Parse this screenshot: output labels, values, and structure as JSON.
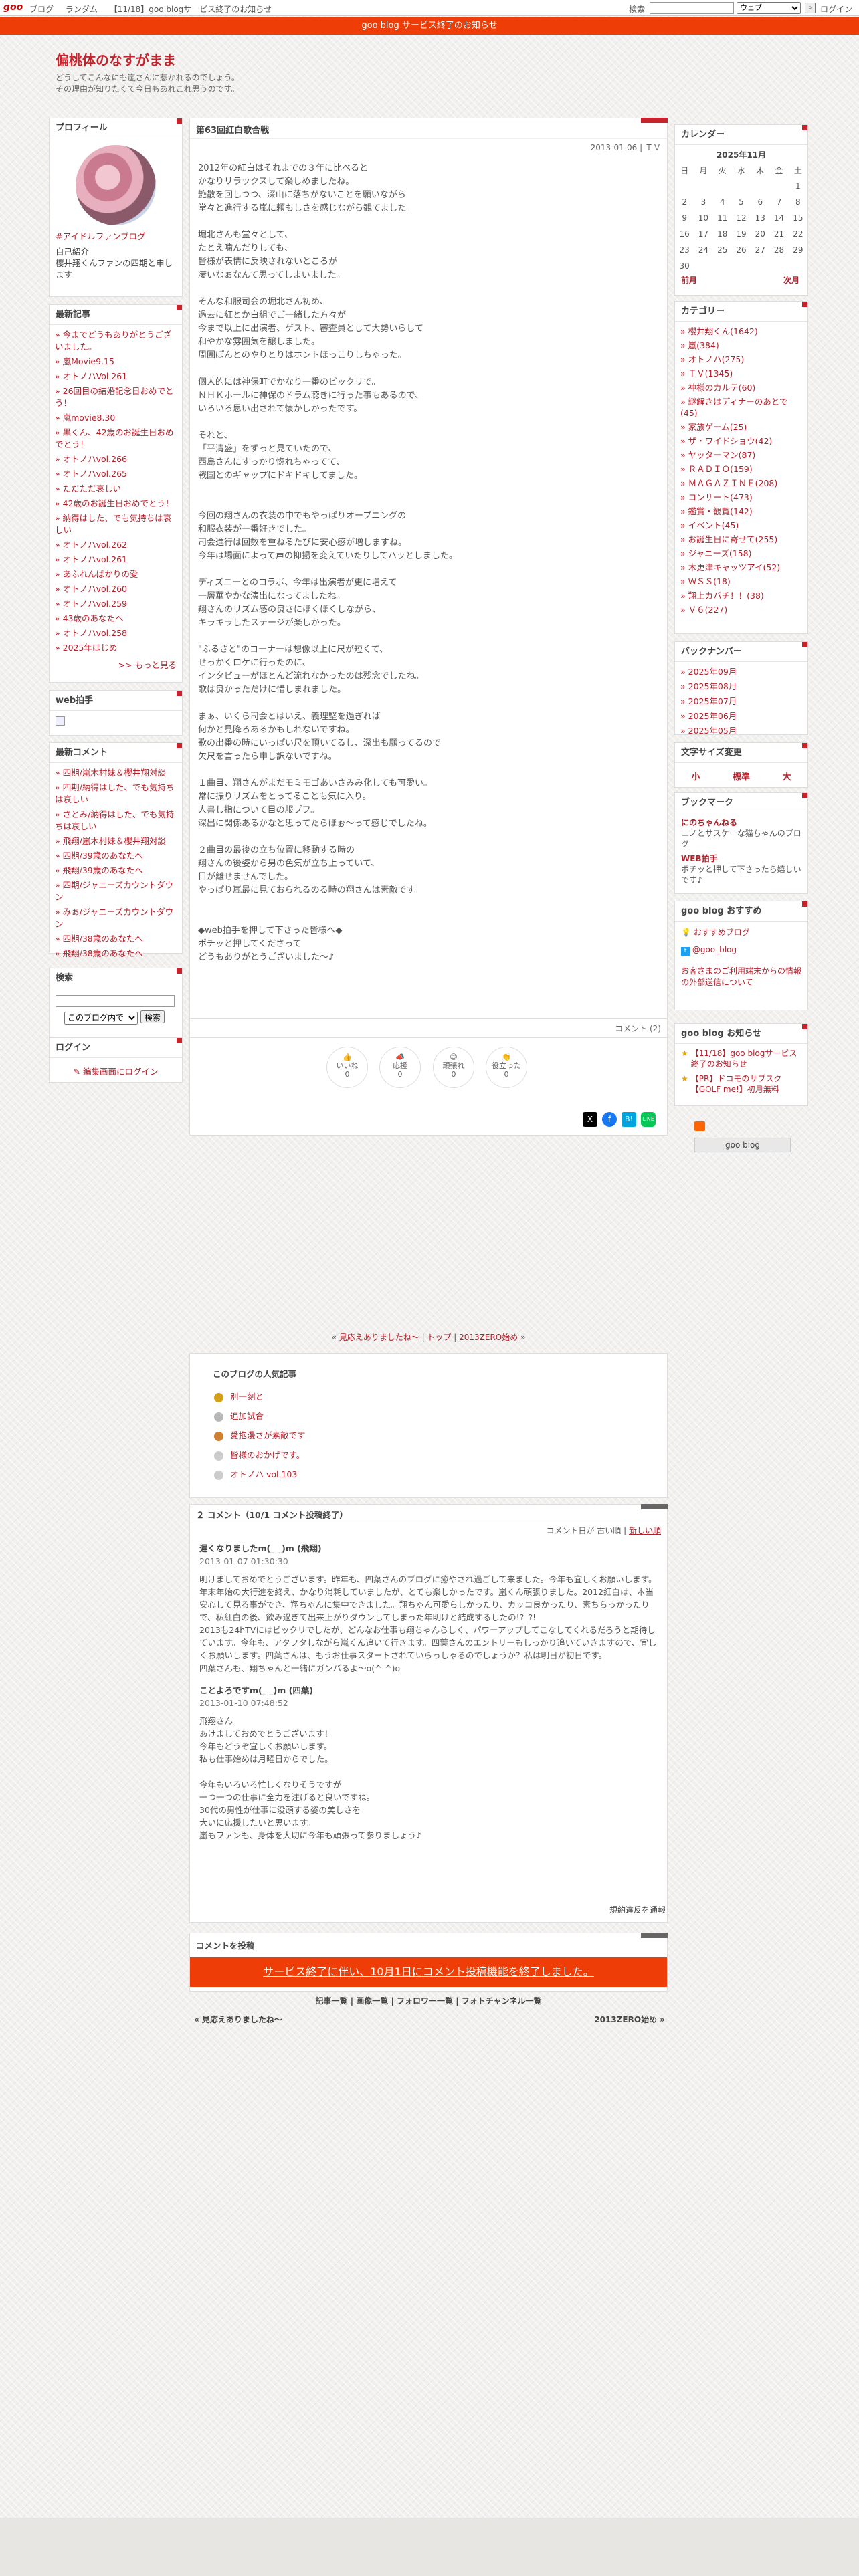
{
  "topbar": {
    "logo": "goo",
    "links": [
      "ブログ",
      "ランダム",
      "【11/18】goo blogサービス終了のお知らせ"
    ],
    "search_label": "検索",
    "search_select": "ウェブ",
    "login": "ログイン"
  },
  "notice": "goo blog サービス終了のお知らせ",
  "blog": {
    "title": "偏桃体のなすがまま",
    "desc_line1": "どうしてこんなにも嵐さんに惹かれるのでしょう。",
    "desc_line2": "その理由が知りたくて今日もあれこれ思うのです。"
  },
  "profile": {
    "heading": "プロフィール",
    "link": "#アイドルファンブログ",
    "intro_title": "自己紹介",
    "intro": "櫻井翔くんファンの四期と申します。"
  },
  "recent": {
    "heading": "最新記事",
    "items": [
      "今までどうもありがとうございました。",
      "嵐Movie9.15",
      "オトノハVol.261",
      "26回目の結婚記念日おめでとう！",
      "嵐movie8.30",
      "黒くん、42歳のお誕生日おめでとう！",
      "オトノハvol.266",
      "オトノハvol.265",
      "ただただ哀しい",
      "42歳のお誕生日おめでとう！",
      "納得はした、でも気持ちは哀しい",
      "オトノハvol.262",
      "オトノハvol.261",
      "あふれんばかりの愛",
      "オトノハvol.260",
      "オトノハvol.259",
      "43歳のあなたへ",
      "オトノハvol.258",
      "2025年ほじめ"
    ],
    "more": ">> もっと見る"
  },
  "webclap": {
    "heading": "web拍手"
  },
  "comments_side": {
    "heading": "最新コメント",
    "items": [
      "四期/嵐木村妹＆櫻井翔対談",
      "四期/納得はした、でも気持ちは哀しい",
      "さとみ/納得はした、でも気持ちは哀しい",
      "飛翔/嵐木村妹＆櫻井翔対談",
      "四期/39歳のあなたへ",
      "飛翔/39歳のあなたへ",
      "四期/ジャニーズカウントダウン",
      "みぁ/ジャニーズカウントダウン",
      "四期/38歳のあなたへ",
      "飛翔/38歳のあなたへ"
    ]
  },
  "search_side": {
    "heading": "検索",
    "select": "このブログ内で",
    "button": "検索"
  },
  "login_side": {
    "heading": "ログイン",
    "link": "編集画面にログイン"
  },
  "post": {
    "title": "第63回紅白歌合戦",
    "meta": "2013-01-06 | ＴＶ",
    "body": "2012年の紅白はそれまでの３年に比べると\nかなりリラックスして楽しめましたね。\n艶散を回しつつ、深山に落ちがないことを願いながら\n堂々と進行する嵐に頼もしさを感じながら観てました。\n\n堀北さんも堂々として、\nたとえ噛んだりしても、\n皆様が表情に反映されないところが\n凄いなぁなんて思ってしまいました。\n\nそんな和服司会の堀北さん初め、\n過去に紅とか白組でご一緒した方々が\n今まで以上に出演者、ゲスト、審査員として大勢いらして\n和やかな雰囲気を醸しました。\n周囲ぽんとのやりとりはホントほっこりしちゃった。\n\n個人的には神保町でかなり一番のビックリで。\nＮＨＫホールに神保のドラム聴きに行った事もあるので、\nいろいろ思い出されて懐かしかったです。\n\nそれと、\n「平清盛」をずっと見ていたので、\n西島さんにすっかり惚れちゃってて、\n戦国とのギャップにドキドキしてました。\n\n\n今回の翔さんの衣装の中でもやっぱりオープニングの\n和服衣装が一番好きでした。\n司会進行は回数を重ねるたびに安心感が増しますね。\n今年は場面によって声の抑揚を変えていたりしてハッとしました。\n\nディズニーとのコラボ、今年は出演者が更に増えて\n一層華やかな演出になってましたね。\n翔さんのリズム感の良さにほくほくしながら、\nキラキラしたステージが楽しかった。\n\n\"ふるさと\"のコーナーは想像以上に尺が短くて、\nせっかくロケに行ったのに、\nインタビューがほとんど流れなかったのは残念でしたね。\n歌は良かっただけに惜しまれました。\n\nまぁ、いくら司会とはいえ、義理堅を過ぎれば\n何かと見降ろあるかもしれないですね。\n歌の出番の時にいっぱい尺を頂いてるし、深出も願ってるので\n欠尺を言ったら申し訳ないですね。\n\n１曲目、翔さんがまだモミモゴあいさみみ化しても可愛い。\n常に振りリズムをとってることも気に入り。\n人書し指について目の服プフ。\n深出に関係あるかなと思ってたらほぉ～って感じでしたね。\n\n２曲目の最後の立ち位置に移動する時の\n翔さんの後姿から男の色気が立ち上っていて、\n目が離せませんでした。\nやっぱり嵐最に見ておられるのる時の翔さんは素敵です。\n\n\n◆web拍手を押して下さった皆様へ◆\nポチッと押してくださって\nどうもありがとうございました～♪",
    "comments_link": "コメント (2)"
  },
  "reactions": [
    {
      "label": "いいね",
      "count": "0"
    },
    {
      "label": "応援",
      "count": "0"
    },
    {
      "label": "頑張れ",
      "count": "0"
    },
    {
      "label": "役立った",
      "count": "0"
    }
  ],
  "calendar": {
    "heading": "カレンダー",
    "month": "2025年11月",
    "weekdays": [
      "日",
      "月",
      "火",
      "水",
      "木",
      "金",
      "土"
    ],
    "rows": [
      [
        "",
        "",
        "",
        "",
        "",
        "",
        "1"
      ],
      [
        "2",
        "3",
        "4",
        "5",
        "6",
        "7",
        "8"
      ],
      [
        "9",
        "10",
        "11",
        "12",
        "13",
        "14",
        "15"
      ],
      [
        "16",
        "17",
        "18",
        "19",
        "20",
        "21",
        "22"
      ],
      [
        "23",
        "24",
        "25",
        "26",
        "27",
        "28",
        "29"
      ],
      [
        "30",
        "",
        "",
        "",
        "",
        "",
        ""
      ]
    ],
    "prev": "前月",
    "next": "次月"
  },
  "categories": {
    "heading": "カテゴリー",
    "items": [
      "櫻井翔くん(1642)",
      "嵐(384)",
      "オトノハ(275)",
      "ＴＶ(1345)",
      "神様のカルテ(60)",
      "謎解きはディナーのあとで(45)",
      "家族ゲーム(25)",
      "ザ・ワイドショウ(42)",
      "ヤッターマン(87)",
      "ＲＡＤＩＯ(159)",
      "ＭＡＧＡＺＩＮＥ(208)",
      "コンサート(473)",
      "鑑賞・観覧(142)",
      "イベント(45)",
      "お誕生日に寄せて(255)",
      "ジャニーズ(158)",
      "木更津キャッツアイ(52)",
      "ＷＳＳ(18)",
      "翔上カバチ！！(38)",
      "Ｖ６(227)"
    ]
  },
  "backnumber": {
    "heading": "バックナンバー",
    "items": [
      "2025年09月",
      "2025年08月",
      "2025年07月",
      "2025年06月",
      "2025年05月"
    ]
  },
  "fontsize": {
    "heading": "文字サイズ変更",
    "small": "小",
    "mid": "標準",
    "large": "大"
  },
  "bookmarks": {
    "heading": "ブックマーク",
    "items": [
      {
        "name": "にのちゃんねる",
        "desc": "ニノとサスケーな猫ちゃんのブログ"
      },
      {
        "name": "WEB拍手",
        "desc": "ポチッと押して下さったら嬉しいです♪"
      }
    ]
  },
  "goo_recommend": {
    "heading": "goo blog おすすめ",
    "items": [
      "おすすめブログ",
      "@goo_blog"
    ],
    "note": "お客さまのご利用端末からの情報の外部送信について"
  },
  "goo_notice": {
    "heading": "goo blog お知らせ",
    "items": [
      "【11/18】goo blogサービス終了のお知らせ",
      "【PR】ドコモのサブスク【GOLF me!】初月無料"
    ]
  },
  "goo_banner": "goo blog",
  "nav": {
    "prev": "見応えありましたね～",
    "top": "トップ",
    "next": "2013ZERO始め"
  },
  "popular": {
    "heading": "このブログの人気記事",
    "items": [
      "別一刻と",
      "追加試合",
      "愛抱漫さが素敵です",
      "皆様のおかげです。",
      "オトノハ vol.103"
    ]
  },
  "comments": {
    "heading": "２ コメント（10/1 コメント投稿終了）",
    "sort_label": "コメント日が",
    "sort_old": "古い順",
    "sort_new": "新しい順",
    "list": [
      {
        "author": "遅くなりましたm(_ _)m (飛翔)",
        "date": "2013-01-07 01:30:30",
        "body": "明けましておめでとうございます。昨年も、四葉さんのブログに癒やされ過ごして来ました。今年も宜しくお願いします。\n年末年始の大行進を終え、かなり消耗していましたが、とても楽しかったです。嵐くん頑張りました。2012紅白は、本当安心して見る事ができ、翔ちゃんに集中できました。翔ちゃん可愛らしかったり、カッコ良かったり、素ちらっかったり。で、私紅白の後、飲み過ぎて出来上がりダウンしてしまった年明けと結成するしたの!?_?!\n2013も24hTVにはビックリでしたが、どんなお仕事も翔ちゃんらしく、パワーアップしてこなしてくれるだろうと期待しています。今年も、アタフタしながら嵐くん追いて行きます。四葉さんのエントリーもしっかり追いていきますので、宜しくお願いします。四葉さんは、もうお仕事スタートされていらっしゃるのでしょうか？私は明日が初日です。\n四葉さんも、翔ちゃんと一緒にガンバるよ〜o(^-^)o"
      },
      {
        "author": "ことよろですm(_ _)m (四葉)",
        "date": "2013-01-10 07:48:52",
        "body": "飛翔さん\nあけましておめでとうございます！\n今年もどうぞ宜しくお願いします。\n私も仕事始めは月曜日からでした。\n\n今年もいろいろ忙しくなりそうですが\n一つ一つの仕事に全力を注げると良いですね。\n30代の男性が仕事に没頭する姿の美しさを\n大いに応援したいと思います。\n嵐もファンも、身体を大切に今年も頑張って参りましょう♪"
      }
    ]
  },
  "report_link": "規約違反を通報",
  "comment_post": {
    "heading": "コメントを投稿",
    "banner": "サービス終了に伴い、10月1日にコメント投稿機能を終了しました。"
  },
  "footer_links": [
    "記事一覧",
    "画像一覧",
    "フォロワー一覧",
    "フォトチャンネル一覧"
  ],
  "footer_nav": {
    "prev": "« 見応えありましたね～",
    "next": "2013ZERO始め »"
  }
}
